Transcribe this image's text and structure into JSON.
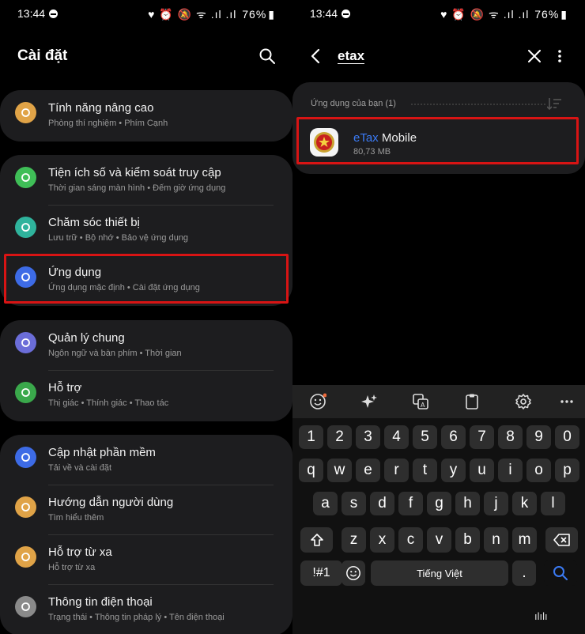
{
  "status": {
    "time": "13:44",
    "battery": "76%",
    "icons_text": "♥ ⏰ 🔕 ᯤ .ıl .ıl"
  },
  "left": {
    "title": "Cài đặt",
    "groups": [
      {
        "items": [
          {
            "icon": "lab-icon",
            "color": "#e0a347",
            "title": "Tính năng nâng cao",
            "subtitle": "Phòng thí nghiệm  •  Phím Cạnh"
          }
        ]
      },
      {
        "items": [
          {
            "icon": "wellbeing-icon",
            "color": "#3fbe57",
            "title": "Tiện ích số và kiểm soát truy cập",
            "subtitle": "Thời gian sáng màn hình  •  Đếm giờ ứng dụng"
          },
          {
            "icon": "device-care-icon",
            "color": "#2fb39c",
            "title": "Chăm sóc thiết bị",
            "subtitle": "Lưu trữ  •  Bộ nhớ  •  Bảo vệ ứng dụng"
          },
          {
            "icon": "apps-icon",
            "color": "#3d6be6",
            "title": "Ứng dụng",
            "subtitle": "Ứng dụng mặc định  •  Cài đặt ứng dụng"
          }
        ]
      },
      {
        "items": [
          {
            "icon": "general-management-icon",
            "color": "#6b6dd8",
            "title": "Quản lý chung",
            "subtitle": "Ngôn ngữ và bàn phím  •  Thời gian"
          },
          {
            "icon": "accessibility-icon",
            "color": "#3aa84b",
            "title": "Hỗ trợ",
            "subtitle": "Thị giác  •  Thính giác  •  Thao tác"
          }
        ]
      },
      {
        "items": [
          {
            "icon": "software-update-icon",
            "color": "#3d6be6",
            "title": "Cập nhật phần mềm",
            "subtitle": "Tải về và cài đặt"
          },
          {
            "icon": "user-manual-icon",
            "color": "#e0a347",
            "title": "Hướng dẫn người dùng",
            "subtitle": "Tìm hiểu thêm"
          },
          {
            "icon": "remote-support-icon",
            "color": "#e0a347",
            "title": "Hỗ trợ từ xa",
            "subtitle": "Hỗ trợ từ xa"
          },
          {
            "icon": "about-phone-icon",
            "color": "#8a8a8a",
            "title": "Thông tin điện thoại",
            "subtitle": "Trạng thái  •  Thông tin pháp lý  •  Tên điện thoại"
          }
        ]
      }
    ]
  },
  "right": {
    "search_query": "etax",
    "section_label": "Ứng dụng của bạn (1)",
    "result": {
      "name_match": "eTax",
      "name_rest": " Mobile",
      "size": "80,73 MB"
    },
    "keyboard": {
      "number_row": [
        "1",
        "2",
        "3",
        "4",
        "5",
        "6",
        "7",
        "8",
        "9",
        "0"
      ],
      "row1": [
        "q",
        "w",
        "e",
        "r",
        "t",
        "y",
        "u",
        "i",
        "o",
        "p"
      ],
      "row2": [
        "a",
        "s",
        "d",
        "f",
        "g",
        "h",
        "j",
        "k",
        "l"
      ],
      "row3": [
        "z",
        "x",
        "c",
        "v",
        "b",
        "n",
        "m"
      ],
      "symbols_key": "!#1",
      "space_label": "Tiếng Việt",
      "period_key": "."
    },
    "gesture_hint": "ılılı"
  },
  "colors": {
    "highlight": "#d81414",
    "accent": "#3b7bf5",
    "card": "#1d1d1f"
  }
}
